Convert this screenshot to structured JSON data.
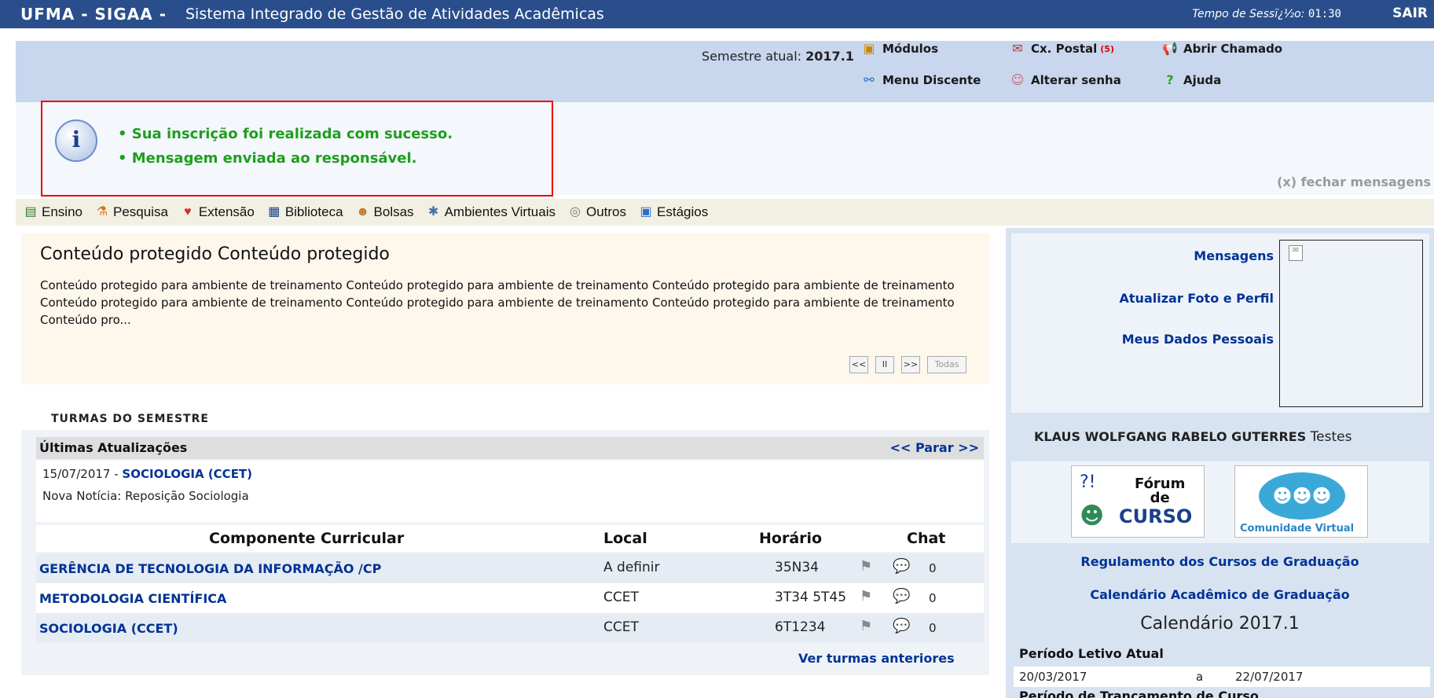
{
  "topbar": {
    "brand": "UFMA - SIGAA -",
    "system_name": "Sistema Integrado de Gestão de Atividades Acadêmicas",
    "session_label": "Tempo de Sessï¿½o:",
    "session_time": "01:30",
    "logout": "SAIR"
  },
  "header": {
    "semester_label": "Semestre atual:",
    "semester_value": "2017.1",
    "links": {
      "modulos": "Módulos",
      "cx_postal": "Cx. Postal",
      "cx_postal_count": "(5)",
      "abrir_chamado": "Abrir Chamado",
      "menu_discente": "Menu Discente",
      "alterar_senha": "Alterar senha",
      "ajuda": "Ajuda"
    }
  },
  "messages": {
    "items": [
      "• Sua inscrição foi realizada com sucesso.",
      "• Mensagem enviada ao responsável."
    ],
    "close": "(x) fechar mensagens"
  },
  "menu": [
    "Ensino",
    "Pesquisa",
    "Extensão",
    "Biblioteca",
    "Bolsas",
    "Ambientes Virtuais",
    "Outros",
    "Estágios"
  ],
  "news": {
    "title": "Conteúdo protegido Conteúdo protegido",
    "body": "Conteúdo protegido para ambiente de treinamento Conteúdo protegido para ambiente de treinamento Conteúdo protegido para ambiente de treinamento Conteúdo protegido para ambiente de treinamento Conteúdo protegido para ambiente de treinamento Conteúdo protegido para ambiente de treinamento Conteúdo pro...",
    "prev": "<<",
    "pause": "II",
    "next": ">>",
    "all": "Todas"
  },
  "turmas": {
    "title": "Turmas do Semestre",
    "updates_label": "Últimas Atualizações",
    "stop": "<< Parar >>",
    "update_date": "15/07/2017 -",
    "update_course": "SOCIOLOGIA (CCET)",
    "update_news": "Nova Notícia: Reposição Sociologia",
    "columns": [
      "Componente Curricular",
      "Local",
      "Horário",
      "Chat"
    ],
    "rows": [
      {
        "name": "GERÊNCIA DE TECNOLOGIA DA INFORMAÇÃO /CP",
        "local": "A definir",
        "horario": "35N34",
        "chat": "0"
      },
      {
        "name": "METODOLOGIA CIENTÍFICA",
        "local": "CCET",
        "horario": "3T34 5T45",
        "chat": "0"
      },
      {
        "name": "SOCIOLOGIA (CCET)",
        "local": "CCET",
        "horario": "6T1234",
        "chat": "0"
      }
    ],
    "previous": "Ver turmas anteriores"
  },
  "profile": {
    "mensagens": "Mensagens",
    "atualizar_foto": "Atualizar Foto e Perfil",
    "meus_dados": "Meus Dados Pessoais",
    "user_name": "KLAUS WOLFGANG RABELO GUTERRES",
    "user_role": "Testes"
  },
  "banners": {
    "forum_top": "Fórum",
    "forum_mid": "de",
    "forum_bottom": "CURSO",
    "comunidade": "Comunidade Virtual"
  },
  "links": {
    "regulamento": "Regulamento dos Cursos de Graduação",
    "calendario": "Calendário Acadêmico de Graduação"
  },
  "calendar": {
    "title": "Calendário 2017.1",
    "periodo_label": "Período Letivo Atual",
    "start": "20/03/2017",
    "sep": "a",
    "end": "22/07/2017",
    "trancamento_label": "Período de Trancamento de Curso"
  }
}
